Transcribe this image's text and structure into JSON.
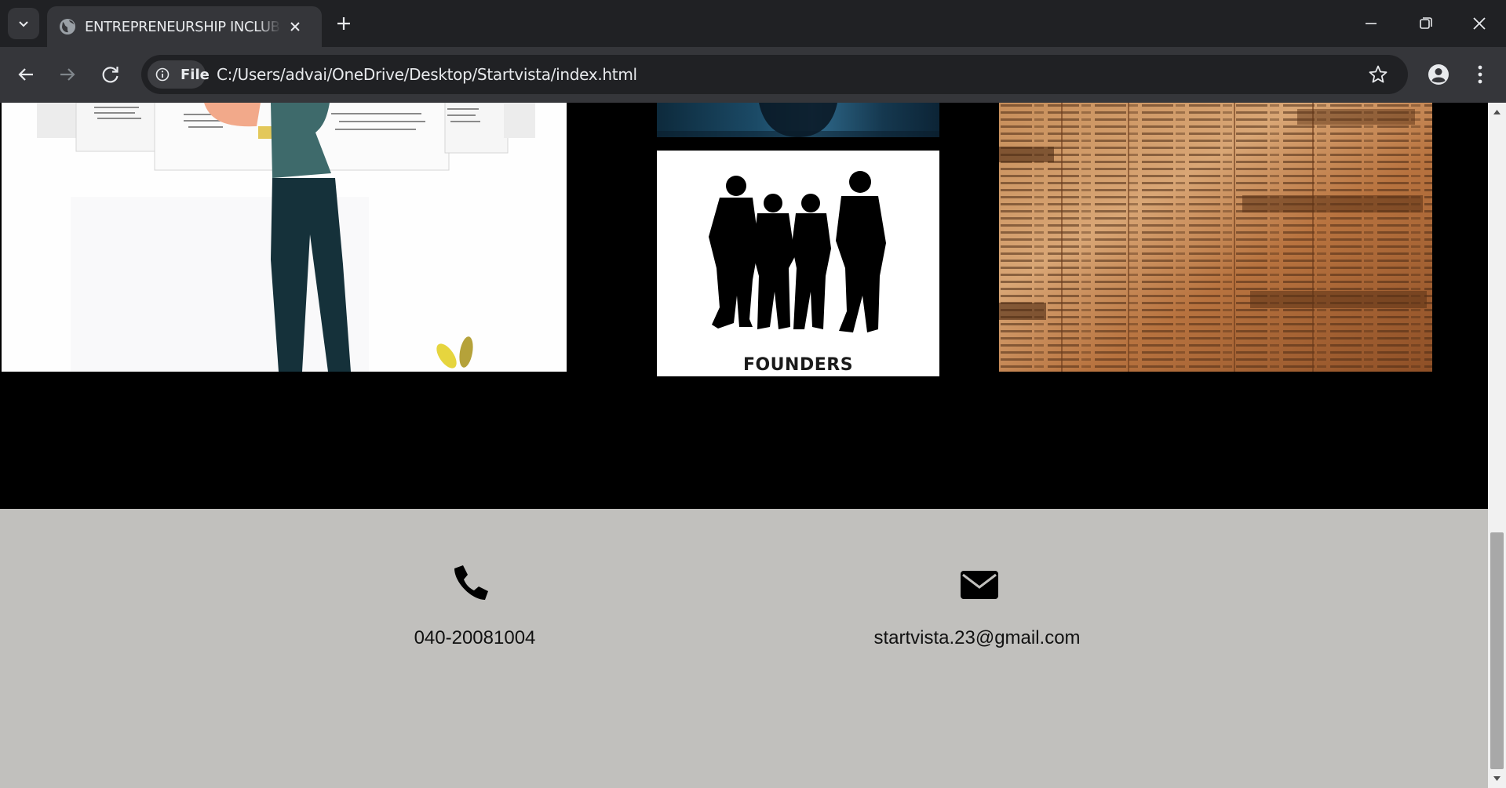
{
  "browser": {
    "tab_title": "ENTREPRENEURSHIP INCLUBLATOR",
    "site_chip_label": "File",
    "url": "C:/Users/advai/OneDrive/Desktop/Startvista/index.html",
    "theme": {
      "tabstrip": "#202124",
      "toolbar": "#35363a",
      "omnibox": "#202124",
      "text": "#e8eaed"
    },
    "icons": {
      "tab_search": "chevron-down-icon",
      "favicon": "globe-icon",
      "tab_close": "close-icon",
      "new_tab": "plus-icon",
      "minimize": "minimize-icon",
      "restore": "restore-icon",
      "close_window": "close-icon",
      "back": "arrow-left-icon",
      "forward": "arrow-right-icon",
      "reload": "reload-icon",
      "site_info": "info-icon",
      "bookmark": "star-icon",
      "profile": "person-icon",
      "menu": "kebab-menu-icon"
    }
  },
  "gallery": {
    "background": "#000000",
    "images": [
      {
        "name": "illustration",
        "caption": ""
      },
      {
        "name": "business",
        "caption": ""
      },
      {
        "name": "founders",
        "caption": "FOUNDERS"
      },
      {
        "name": "newspaper",
        "caption": ""
      }
    ]
  },
  "footer": {
    "background": "#c1c0bd",
    "phone": {
      "icon": "phone-icon",
      "text": "040-20081004"
    },
    "email": {
      "icon": "envelope-icon",
      "text": "startvista.23@gmail.com"
    }
  }
}
